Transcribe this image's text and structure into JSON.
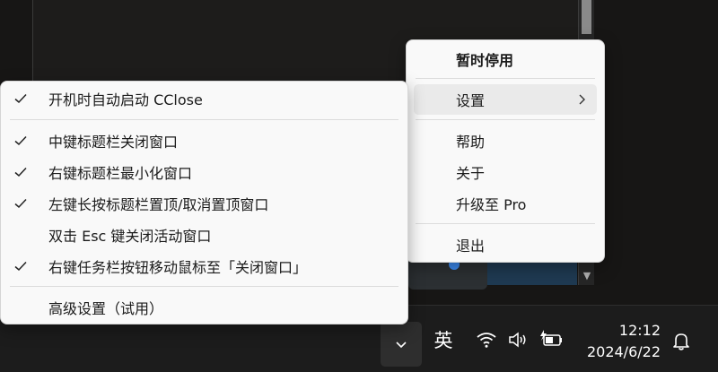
{
  "main_menu": {
    "items": [
      {
        "label": "暂时停用",
        "bold": true
      },
      {
        "label": "设置",
        "has_submenu": true,
        "highlighted": true
      },
      {
        "label": "帮助"
      },
      {
        "label": "关于"
      },
      {
        "label": "升级至 Pro"
      },
      {
        "label": "退出"
      }
    ]
  },
  "settings_submenu": {
    "items": [
      {
        "label": "开机时自动启动 CClose",
        "checked": true
      },
      {
        "label": "中键标题栏关闭窗口",
        "checked": true
      },
      {
        "label": "右键标题栏最小化窗口",
        "checked": true
      },
      {
        "label": "左键长按标题栏置顶/取消置顶窗口",
        "checked": true
      },
      {
        "label": "双击 Esc 键关闭活动窗口",
        "checked": false
      },
      {
        "label": "右键任务栏按钮移动鼠标至「关闭窗口」",
        "checked": true
      },
      {
        "label": "高级设置（试用）",
        "checked": false
      }
    ]
  },
  "taskbar": {
    "input_language": "英",
    "time": "12:12",
    "date": "2024/6/22",
    "icons": [
      "chevron-up-icon",
      "wifi-icon",
      "volume-icon",
      "battery-charging-icon",
      "bell-icon"
    ]
  },
  "colors": {
    "menu_bg": "#f9f9f9",
    "highlight_bg": "#eaeaea",
    "taskbar_bg": "#1c1c1c",
    "accent_blue": "#3d8bf2"
  }
}
